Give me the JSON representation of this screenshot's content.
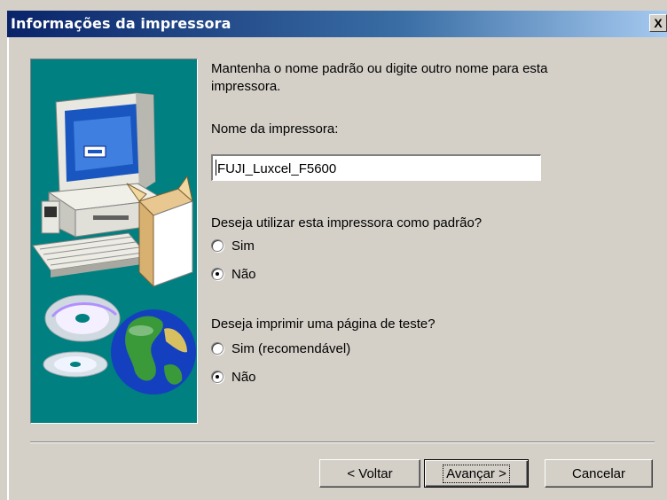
{
  "window": {
    "title": "Informações da impressora",
    "close_label": "X"
  },
  "content": {
    "intro": "Mantenha o nome padrão ou digite outro nome para esta impressora.",
    "name_label": "Nome da impressora:",
    "printer_name": "FUJI_Luxcel_F5600",
    "default_question": "Deseja utilizar esta impressora como padrão?",
    "default_options": [
      {
        "label": "Sim",
        "checked": false
      },
      {
        "label": "Não",
        "checked": true
      }
    ],
    "test_question": "Deseja imprimir uma página de teste?",
    "test_options": [
      {
        "label": "Sim (recomendável)",
        "checked": false
      },
      {
        "label": "Não",
        "checked": true
      }
    ]
  },
  "buttons": {
    "back": "< Voltar",
    "next": "Avançar >",
    "cancel": "Cancelar"
  },
  "colors": {
    "dialog_bg": "#d4d0c8",
    "wizard_bg": "#008080",
    "title_start": "#0a246a"
  },
  "icons": {
    "wizard": "printer-setup-illustration",
    "close": "close-icon"
  }
}
